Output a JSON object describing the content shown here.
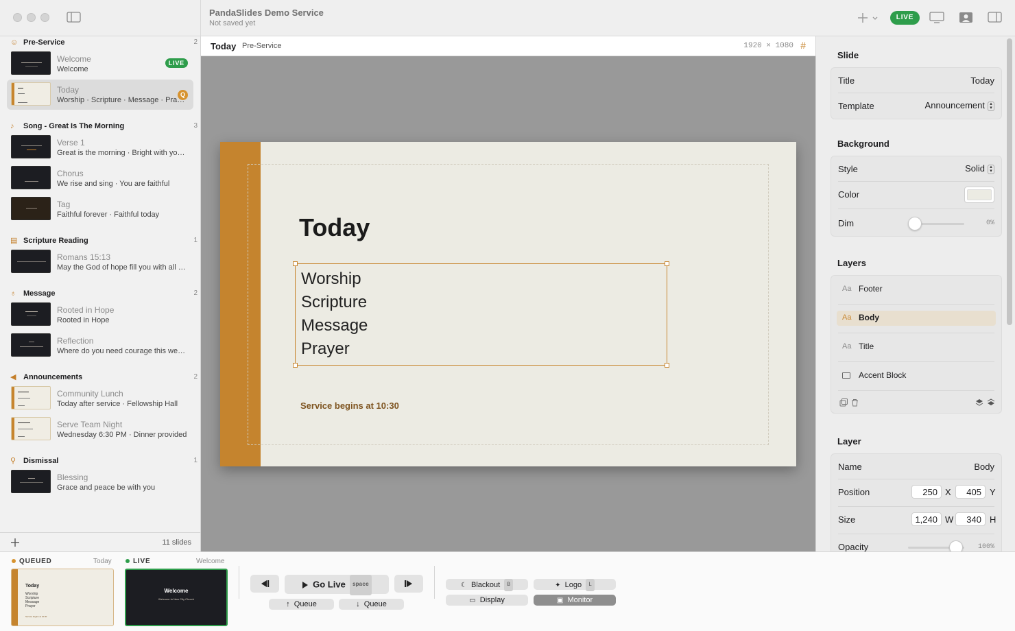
{
  "app": {
    "doc_title": "PandaSlides Demo Service",
    "doc_status": "Not saved yet",
    "live_label": "LIVE"
  },
  "sidebar": {
    "sections": [
      {
        "name": "Pre-Service",
        "count": "2",
        "icon": "hand-wave-icon",
        "items": [
          {
            "title": "Welcome",
            "subtitle": "Welcome",
            "badge": "LIVE",
            "theme": "dark"
          },
          {
            "title": "Today",
            "subtitle": "Worship · Scripture · Message · Prayer",
            "badge": "Q",
            "theme": "light",
            "selected": true
          }
        ]
      },
      {
        "name": "Song - Great Is The Morning",
        "count": "3",
        "icon": "music-note-icon",
        "items": [
          {
            "title": "Verse 1",
            "subtitle": "Great is the morning · Bright with your glory",
            "theme": "dark"
          },
          {
            "title": "Chorus",
            "subtitle": "We rise and sing · You are faithful",
            "theme": "dark"
          },
          {
            "title": "Tag",
            "subtitle": "Faithful forever · Faithful today",
            "theme": "dark-warm"
          }
        ]
      },
      {
        "name": "Scripture Reading",
        "count": "1",
        "icon": "book-icon",
        "items": [
          {
            "title": "Romans 15:13",
            "subtitle": "May the God of hope fill you with all joy",
            "theme": "dark"
          }
        ]
      },
      {
        "name": "Message",
        "count": "2",
        "icon": "microphone-icon",
        "items": [
          {
            "title": "Rooted in Hope",
            "subtitle": "Rooted in Hope",
            "theme": "dark"
          },
          {
            "title": "Reflection",
            "subtitle": "Where do you need courage this week?",
            "theme": "dark"
          }
        ]
      },
      {
        "name": "Announcements",
        "count": "2",
        "icon": "megaphone-icon",
        "items": [
          {
            "title": "Community Lunch",
            "subtitle": "Today after service · Fellowship Hall",
            "theme": "light"
          },
          {
            "title": "Serve Team Night",
            "subtitle": "Wednesday 6:30 PM · Dinner provided",
            "theme": "light"
          }
        ]
      },
      {
        "name": "Dismissal",
        "count": "1",
        "icon": "walking-person-icon",
        "items": [
          {
            "title": "Blessing",
            "subtitle": "Grace and peace be with you",
            "theme": "dark"
          }
        ]
      }
    ],
    "footer_count": "11 slides"
  },
  "canvas": {
    "slide_name": "Today",
    "section_name": "Pre-Service",
    "resolution": "1920 × 1080",
    "slide": {
      "title": "Today",
      "body": [
        "Worship",
        "Scripture",
        "Message",
        "Prayer"
      ],
      "footer": "Service begins at 10:30"
    }
  },
  "inspector": {
    "slide_header": "Slide",
    "title_label": "Title",
    "title_value": "Today",
    "template_label": "Template",
    "template_value": "Announcement",
    "background_header": "Background",
    "style_label": "Style",
    "style_value": "Solid",
    "color_label": "Color",
    "color_value": "#ecebe3",
    "dim_label": "Dim",
    "dim_value": "0%",
    "layers_header": "Layers",
    "layers": [
      {
        "prefix": "Aa",
        "name": "Footer"
      },
      {
        "prefix": "Aa",
        "name": "Body",
        "selected": true
      },
      {
        "prefix": "Aa",
        "name": "Title"
      },
      {
        "prefix": "",
        "name": "Accent Block"
      }
    ],
    "layer_header": "Layer",
    "name_label": "Name",
    "name_value": "Body",
    "position_label": "Position",
    "pos_x": "250",
    "pos_x_label": "X",
    "pos_y": "405",
    "pos_y_label": "Y",
    "size_label": "Size",
    "size_w": "1,240",
    "size_w_label": "W",
    "size_h": "340",
    "size_h_label": "H",
    "opacity_label": "Opacity",
    "opacity_value": "100%"
  },
  "bottom": {
    "queued_label": "QUEUED",
    "queued_name": "Today",
    "live_label": "LIVE",
    "live_name": "Welcome",
    "live_preview_title": "Welcome",
    "live_preview_sub": "Welcome to New City Church",
    "queued_preview_footer": "Service begins at 10:30",
    "go_live": "Go Live",
    "go_live_key": "space",
    "queue_up": "Queue",
    "queue_down": "Queue",
    "blackout": "Blackout",
    "blackout_key": "B",
    "logo": "Logo",
    "logo_key": "L",
    "display": "Display",
    "monitor": "Monitor"
  },
  "colors": {
    "accent": "#c5842e",
    "live": "#2e9d4b",
    "queued": "#d7932f"
  }
}
